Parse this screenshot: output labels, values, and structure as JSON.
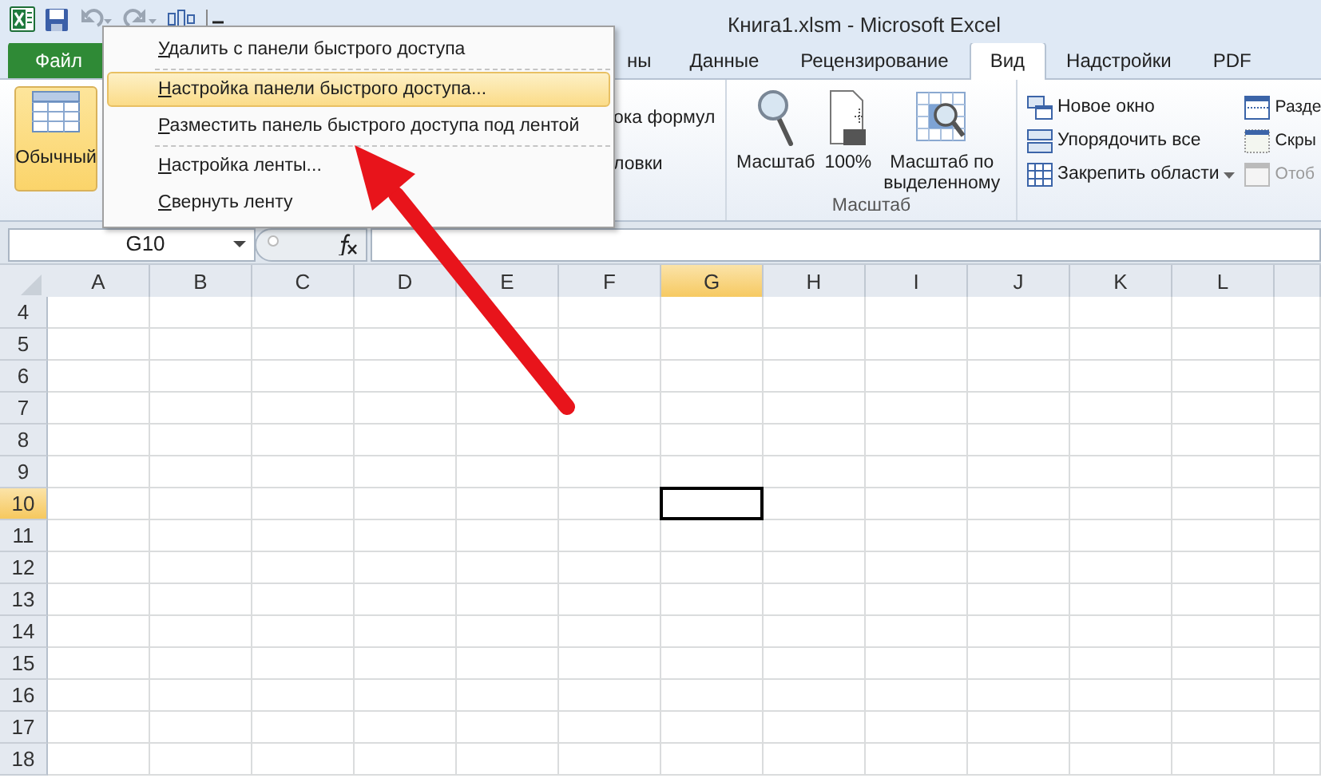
{
  "window": {
    "title": "Книга1.xlsm  -  Microsoft Excel"
  },
  "quick_access": {
    "undo_disabled": true,
    "redo_disabled": true
  },
  "quick_access_menu": {
    "items": [
      {
        "label": "Удалить с панели быстрого доступа",
        "selected": false,
        "separator_before": false
      },
      {
        "label": "Настройка панели быстрого доступа...",
        "selected": true,
        "separator_before": true
      },
      {
        "label": "Разместить панель быстрого доступа под лентой",
        "selected": false,
        "separator_before": false
      },
      {
        "label": "Настройка ленты...",
        "selected": false,
        "separator_before": true
      },
      {
        "label": "Свернуть ленту",
        "selected": false,
        "separator_before": false
      }
    ]
  },
  "tabs": [
    {
      "label": "Файл",
      "kind": "file",
      "selected": false
    },
    {
      "label": "ны",
      "kind": "tab",
      "selected": false
    },
    {
      "label": "Данные",
      "kind": "tab",
      "selected": false
    },
    {
      "label": "Рецензирование",
      "kind": "tab",
      "selected": false
    },
    {
      "label": "Вид",
      "kind": "tab",
      "selected": true
    },
    {
      "label": "Надстройки",
      "kind": "tab",
      "selected": false
    },
    {
      "label": "PDF",
      "kind": "tab",
      "selected": false
    }
  ],
  "ribbon": {
    "views": [
      {
        "label": "Обычный",
        "selected": true
      }
    ],
    "show_items": [
      {
        "label": "ока формул"
      },
      {
        "label": "ловки"
      }
    ],
    "zoom_group": {
      "label": "Масштаб",
      "buttons": [
        {
          "label": "Масштаб",
          "kind": "magnifier"
        },
        {
          "label": "100%",
          "kind": "page"
        },
        {
          "label": "Масштаб по выделенному",
          "kind": "selection"
        }
      ]
    },
    "window_group": {
      "items": [
        {
          "label": "Новое окно",
          "kind": "new-window",
          "disabled": false,
          "dropdown": false
        },
        {
          "label": "Упорядочить все",
          "kind": "arrange",
          "disabled": false,
          "dropdown": false
        },
        {
          "label": "Закрепить области",
          "kind": "freeze",
          "disabled": false,
          "dropdown": true
        },
        {
          "label": "Разде",
          "kind": "split",
          "disabled": false,
          "dropdown": false
        },
        {
          "label": "Скры",
          "kind": "hide",
          "disabled": false,
          "dropdown": false
        },
        {
          "label": "Отоб",
          "kind": "unhide",
          "disabled": true,
          "dropdown": false
        }
      ]
    }
  },
  "formula_bar": {
    "name_box": "G10"
  },
  "grid": {
    "columns": [
      {
        "label": "A",
        "selected": false
      },
      {
        "label": "B",
        "selected": false
      },
      {
        "label": "C",
        "selected": false
      },
      {
        "label": "D",
        "selected": false
      },
      {
        "label": "E",
        "selected": false
      },
      {
        "label": "F",
        "selected": false
      },
      {
        "label": "G",
        "selected": true
      },
      {
        "label": "H",
        "selected": false
      },
      {
        "label": "I",
        "selected": false
      },
      {
        "label": "J",
        "selected": false
      },
      {
        "label": "K",
        "selected": false
      },
      {
        "label": "L",
        "selected": false
      }
    ],
    "rows": [
      {
        "label": "4",
        "selected": false
      },
      {
        "label": "5",
        "selected": false
      },
      {
        "label": "6",
        "selected": false
      },
      {
        "label": "7",
        "selected": false
      },
      {
        "label": "8",
        "selected": false
      },
      {
        "label": "9",
        "selected": false
      },
      {
        "label": "10",
        "selected": true
      },
      {
        "label": "11",
        "selected": false
      },
      {
        "label": "12",
        "selected": false
      },
      {
        "label": "13",
        "selected": false
      },
      {
        "label": "14",
        "selected": false
      },
      {
        "label": "15",
        "selected": false
      },
      {
        "label": "16",
        "selected": false
      },
      {
        "label": "17",
        "selected": false
      },
      {
        "label": "18",
        "selected": false
      }
    ]
  }
}
